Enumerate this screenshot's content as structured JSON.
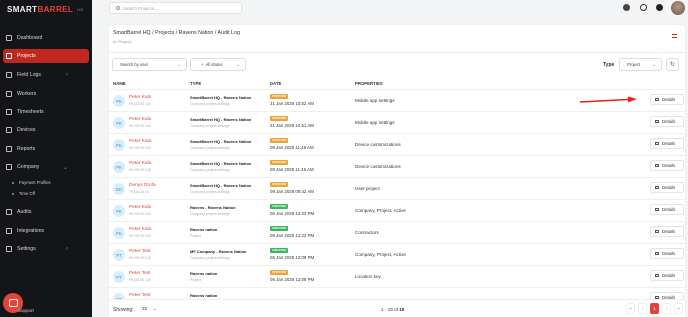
{
  "app": {
    "brand_part1": "SMART",
    "brand_part2": "BARREL",
    "brand_tag": "HR"
  },
  "sidebar": {
    "items": [
      {
        "label": "Dashboard"
      },
      {
        "label": "Projects",
        "active": true
      },
      {
        "label": "Field Logs"
      },
      {
        "label": "Workers"
      },
      {
        "label": "Timesheets"
      },
      {
        "label": "Devices"
      },
      {
        "label": "Reports"
      },
      {
        "label": "Company"
      },
      {
        "label": "Audits"
      },
      {
        "label": "Integrations"
      },
      {
        "label": "Settings"
      }
    ],
    "company_sub": [
      "Payment Profiles",
      "Time Off"
    ],
    "support": "Support"
  },
  "topbar": {
    "search_placeholder": "Search Projects..."
  },
  "page": {
    "breadcrumb": "SmartBarrel HQ  /  Projects  /  Ravens Nation  /  Audit Log",
    "subtitle": "(In Project)"
  },
  "filters": {
    "search_user": "Search by user",
    "status": "All status",
    "type_label": "Type",
    "type_value": "Project"
  },
  "table": {
    "headers": [
      "NAME",
      "TYPE",
      "DATE",
      "PROPERTIES"
    ],
    "details_label": "Details",
    "rows": [
      {
        "initials": "PK",
        "name": "Peter Kalo",
        "ip": "99.232.90.140",
        "type": "SmartBarrel HQ - Ravens Nation",
        "type_sub": "Company project settings",
        "badge": "UPDATED",
        "date": "21 Jan 2025 10:52 AM",
        "props": "Mobile app settings"
      },
      {
        "initials": "PK",
        "name": "Peter Kalo",
        "ip": "99.232.90.140",
        "type": "SmartBarrel HQ - Ravens Nation",
        "type_sub": "Company project settings",
        "badge": "UPDATED",
        "date": "21 Jan 2025 10:51 AM",
        "props": "Mobile app settings"
      },
      {
        "initials": "PK",
        "name": "Peter Kalo",
        "ip": "99.232.90.140",
        "type": "SmartBarrel HQ - Ravens Nation",
        "type_sub": "Company project settings",
        "badge": "UPDATED",
        "date": "09 Jan 2025 11:45 AM",
        "props": "Device customizations"
      },
      {
        "initials": "PK",
        "name": "Peter Kalo",
        "ip": "99.232.90.140",
        "type": "SmartBarrel HQ - Ravens Nation",
        "type_sub": "Company project settings",
        "badge": "UPDATED",
        "date": "09 Jan 2025 11:45 AM",
        "props": "Device customizations"
      },
      {
        "initials": "DD",
        "name": "Denys Drofa",
        "ip": "79.100.43.43",
        "type": "SmartBarrel HQ - Ravens Nation",
        "type_sub": "Company project settings",
        "badge": "UPDATED",
        "date": "09 Jan 2025 09:42 AM",
        "props": "User project"
      },
      {
        "initials": "PK",
        "name": "Peter Kalo",
        "ip": "99.232.90.140",
        "type": "Ravens - Ravens Nation",
        "type_sub": "Company project settings",
        "badge": "CREATED",
        "date": "06 Jan 2025 12:23 PM",
        "props": "Company, Project, Active"
      },
      {
        "initials": "PK",
        "name": "Peter Kalo",
        "ip": "99.232.90.140",
        "type": "Ravens nation",
        "type_sub": "Project",
        "badge": "CREATED",
        "date": "06 Jan 2025 12:22 PM",
        "props": "Contractors"
      },
      {
        "initials": "PT",
        "name": "Peter Test",
        "ip": "99.232.90.140",
        "type": "MF Company - Ravens Nation",
        "type_sub": "Company project settings",
        "badge": "CREATED",
        "date": "06 Jan 2025 12:09 PM",
        "props": "Company, Project, Active"
      },
      {
        "initials": "PT",
        "name": "Peter Test",
        "ip": "99.232.90.140",
        "type": "Ravens nation",
        "type_sub": "Project",
        "badge": "UPDATED",
        "date": "06 Jan 2025 12:09 PM",
        "props": "Location key"
      },
      {
        "initials": "PT",
        "name": "Peter Test",
        "ip": "",
        "type": "Ravens nation",
        "type_sub": "",
        "badge": "",
        "date": "",
        "props": ""
      }
    ]
  },
  "footer": {
    "showing_label": "Showing:",
    "per_page": "25",
    "range_prefix": "1 - 19 of ",
    "range_total": "19",
    "current_page": "1"
  },
  "colors": {
    "accent": "#e2453a",
    "sidebar_bg": "#141518",
    "updated": "#f0a23a",
    "created": "#3cb55b"
  }
}
